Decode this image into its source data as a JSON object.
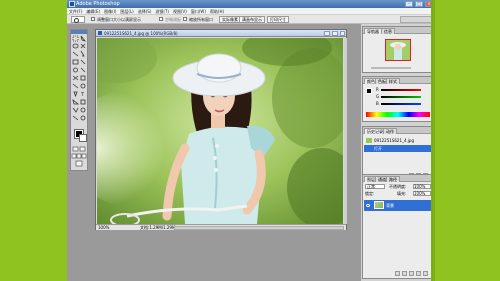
{
  "app": {
    "title": "Adobe Photoshop",
    "window_controls": [
      "-",
      "□",
      "×"
    ]
  },
  "menu": [
    "文件(F)",
    "编辑(E)",
    "图像(I)",
    "图层(L)",
    "选择(S)",
    "滤镜(T)",
    "视图(V)",
    "窗口(W)",
    "帮助(H)"
  ],
  "options": {
    "tool_icon": "zoom-icon",
    "resize_windows_label": "调整窗口大小以满屏显示",
    "ignore_palettes_label": "忽略调板",
    "zoom_all_windows_label": "缩放所有窗口",
    "actual_pixels_button": "实际像素",
    "fit_screen_button": "满画布显示",
    "print_size_button": "打印尺寸"
  },
  "document": {
    "title": "0912251S621_4.jpg @ 100%(RGB/8)",
    "zoom": "100%",
    "info": "文档:1.29M/1.29M"
  },
  "navigator": {
    "tabs": [
      "导航器",
      "信息"
    ]
  },
  "color": {
    "tabs": [
      "颜色",
      "色板",
      "样式"
    ],
    "channels": [
      "R",
      "G",
      "B"
    ]
  },
  "history": {
    "tabs": [
      "历史记录",
      "动作"
    ],
    "rows": [
      "0912251S621_4.jpg",
      "打开"
    ]
  },
  "layers": {
    "tabs": [
      "图层",
      "通道",
      "路径"
    ],
    "blend_mode": "正常",
    "opacity_label": "不透明度:",
    "opacity": "100%",
    "lock_label": "锁定:",
    "fill_label": "填充:",
    "fill": "100%",
    "layer_name": "背景"
  },
  "colors": {
    "background": "#8fc31f",
    "accent": "#2f6fd6",
    "foreground_swatch": "#000000",
    "background_swatch": "#ffffff"
  }
}
